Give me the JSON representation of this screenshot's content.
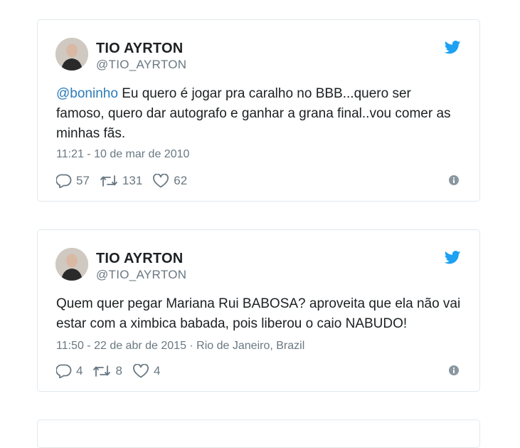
{
  "tweets": [
    {
      "name": "TIO AYRTON",
      "handle": "@TIO_AYRTON",
      "mention": "@boninho",
      "text": " Eu quero é jogar pra caralho no BBB...quero ser famoso, quero dar autografo e ganhar a grana final..vou comer as minhas fãs.",
      "meta": "11:21 - 10 de mar de 2010",
      "replies": "57",
      "retweets": "131",
      "likes": "62"
    },
    {
      "name": "TIO AYRTON",
      "handle": "@TIO_AYRTON",
      "text": "Quem quer pegar Mariana Rui BABOSA? aproveita que ela não vai estar com a ximbica babada, pois liberou o caio NABUDO!",
      "meta": "11:50 - 22 de abr de 2015 · Rio de Janeiro, Brazil",
      "replies": "4",
      "retweets": "8",
      "likes": "4"
    }
  ],
  "colors": {
    "border": "#e1e8ed",
    "mention": "#2b7bb9",
    "twitter_blue": "#1da1f2",
    "muted": "#697882"
  },
  "icons": [
    "twitter-bird-icon",
    "reply-icon",
    "retweet-icon",
    "heart-icon",
    "info-icon"
  ]
}
